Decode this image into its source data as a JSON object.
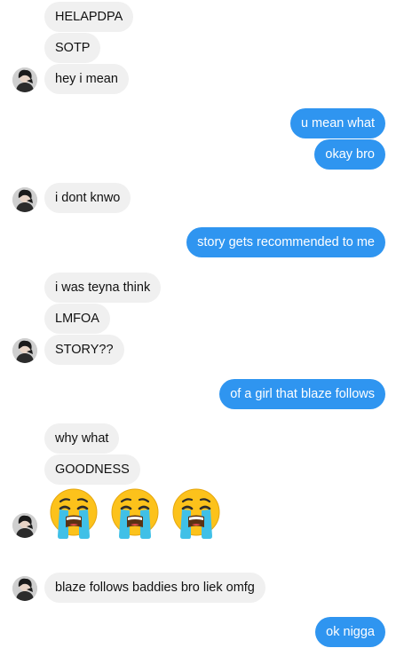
{
  "messages": [
    {
      "text": "HELAPDPA"
    },
    {
      "text": "SOTP"
    },
    {
      "text": "hey i mean"
    },
    {
      "text": "u mean what"
    },
    {
      "text": "okay bro"
    },
    {
      "text": "i dont knwo"
    },
    {
      "text": "story gets recommended to me"
    },
    {
      "text": "i was teyna think"
    },
    {
      "text": "LMFOA"
    },
    {
      "text": "STORY??"
    },
    {
      "text": "of a girl that blaze follows"
    },
    {
      "text": "why what"
    },
    {
      "text": "GOODNESS"
    },
    {
      "text": "blaze follows baddies bro liek omfg"
    },
    {
      "text": "ok nigga"
    }
  ],
  "emoji": {
    "name": "loudly-crying-face-icon",
    "count": 3
  },
  "colors": {
    "outgoing_bubble": "#2f95f0",
    "incoming_bubble": "#f0f0f0",
    "emoji_face": "#fcc21b",
    "emoji_tears": "#40c0e7"
  }
}
